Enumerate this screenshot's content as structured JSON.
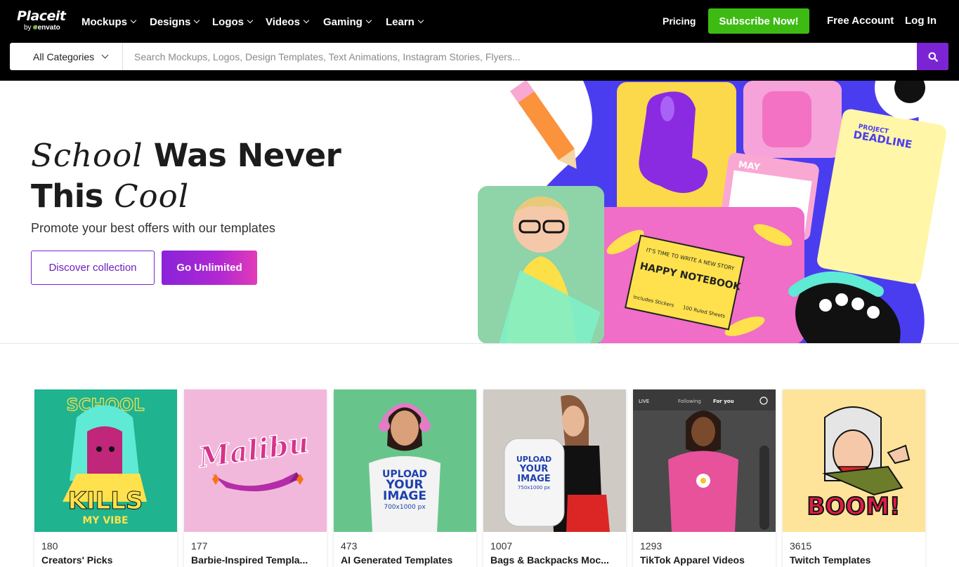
{
  "header": {
    "logo": {
      "brand": "Placeit",
      "by": "by",
      "vendor": "envato"
    },
    "nav": [
      {
        "label": "Mockups"
      },
      {
        "label": "Designs"
      },
      {
        "label": "Logos"
      },
      {
        "label": "Videos"
      },
      {
        "label": "Gaming"
      },
      {
        "label": "Learn"
      }
    ],
    "pricing_label": "Pricing",
    "subscribe_label": "Subscribe Now!",
    "free_account_label": "Free Account",
    "login_label": "Log In",
    "accent_color": "#3dbb13"
  },
  "search": {
    "category": "All Categories",
    "placeholder": "Search Mockups, Logos, Design Templates, Text Animations, Instagram Stories, Flyers...",
    "value": "",
    "button_color": "#7b24d3"
  },
  "hero": {
    "title_script_1": "School",
    "title_bold_1": "Was Never",
    "title_bold_2": "This",
    "title_script_2": "Cool",
    "subtitle": "Promote your best offers with our templates",
    "discover_label": "Discover collection",
    "unlimited_label": "Go Unlimited",
    "art_texts": {
      "deadline": "DEADLINE",
      "project": "PROJECT",
      "may": "MAY",
      "notebook_top": "IT'S TIME TO WRITE A NEW STORY",
      "notebook_title": "HAPPY NOTEBOOK",
      "notebook_foot_1": "Includes Stickers",
      "notebook_foot_2": "100 Ruled Sheets"
    }
  },
  "cards": [
    {
      "count": "180",
      "name": "Creators' Picks",
      "bg": "#1fb38f",
      "art": {
        "top": "SCHOOL",
        "mid": "KILLS",
        "bottom": "MY VIBE"
      }
    },
    {
      "count": "177",
      "name": "Barbie-Inspired Templa...",
      "bg": "#f2b8dc",
      "art": {
        "word": "Malibu"
      }
    },
    {
      "count": "473",
      "name": "AI Generated Templates",
      "bg": "#67c58c",
      "art": {
        "shirt_1": "UPLOAD",
        "shirt_2": "YOUR",
        "shirt_3": "IMAGE",
        "shirt_4": "700x1000 px"
      }
    },
    {
      "count": "1007",
      "name": "Bags & Backpacks Moc...",
      "bg": "#cfcac4",
      "art": {
        "bag_1": "UPLOAD",
        "bag_2": "YOUR",
        "bag_3": "IMAGE",
        "bag_4": "750x1000 px"
      }
    },
    {
      "count": "1293",
      "name": "TikTok Apparel Videos",
      "bg": "#4a4a4a",
      "art": {
        "following": "Following",
        "foryou": "For you",
        "live": "LIVE"
      }
    },
    {
      "count": "3615",
      "name": "Twitch Templates",
      "bg": "#fde49a",
      "art": {
        "word": "BOOM!"
      }
    }
  ]
}
